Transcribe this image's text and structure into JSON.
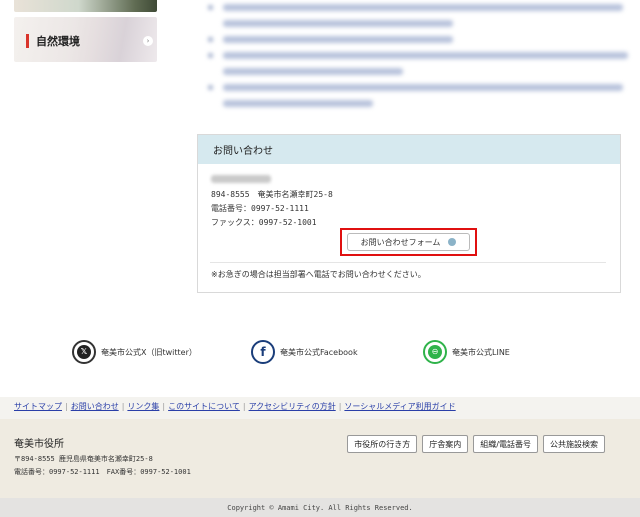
{
  "sidebar": {
    "nature_label": "自然環境"
  },
  "contact": {
    "heading": "お問い合わせ",
    "address": "894-8555　奄美市名瀬幸町25-8",
    "phone": "電話番号：0997-52-1111",
    "fax": "ファックス：0997-52-1001",
    "form_button": "お問い合わせフォーム",
    "note": "※お急ぎの場合は担当部署へ電話でお問い合わせください。"
  },
  "social": {
    "x_label": "奄美市公式X（旧twitter）",
    "facebook_label": "奄美市公式Facebook",
    "line_label": "奄美市公式LINE"
  },
  "footer_links": [
    "サイトマップ",
    "お問い合わせ",
    "リンク集",
    "このサイトについて",
    "アクセシビリティの方針",
    "ソーシャルメディア利用ガイド"
  ],
  "footer": {
    "org_name": "奄美市役所",
    "address": "〒894-8555 鹿児島県奄美市名瀬幸町25-8",
    "phone_fax": "電話番号：0997-52-1111　FAX番号：0997-52-1001",
    "buttons": [
      "市役所の行き方",
      "庁舎案内",
      "組織/電話番号",
      "公共施設検索"
    ],
    "copyright": "Copyright © Amami City. All Rights Reserved."
  },
  "colors": {
    "contact_header_bg": "#d6e9ef",
    "link": "#2a3fa8",
    "highlight_border": "#e01010",
    "footer_bg": "#efebe1"
  }
}
